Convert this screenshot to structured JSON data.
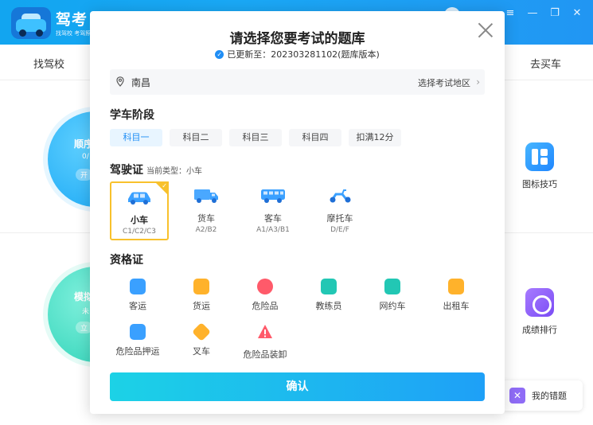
{
  "app": {
    "title": "驾考",
    "subtitle": "找驾校 考驾照"
  },
  "topnav": {
    "left": "找驾校",
    "right": "去买车"
  },
  "background": {
    "circle1": {
      "title": "顺序",
      "sub": "0/",
      "pill": "开"
    },
    "circle2": {
      "title": "模拟",
      "sub": "未",
      "pill": "立"
    },
    "tools": [
      {
        "label": "图标技巧",
        "icon": "grid-icon"
      },
      {
        "label": "成绩排行",
        "icon": "rank-icon"
      }
    ],
    "mistake": {
      "label": "我的错题",
      "icon": "x-icon"
    }
  },
  "modal": {
    "title": "请选择您要考试的题库",
    "update": "已更新至：202303281102(题库版本)",
    "location": {
      "city": "南昌",
      "change_label": "选择考试地区"
    },
    "stage_title": "学车阶段",
    "subjects": [
      "科目一",
      "科目二",
      "科目三",
      "科目四",
      "扣满12分"
    ],
    "active_subject": 0,
    "license_title": "驾驶证",
    "license_current": "当前类型：小车",
    "licenses": [
      {
        "name": "小车",
        "codes": "C1/C2/C3",
        "color": "#3aa0ff"
      },
      {
        "name": "货车",
        "codes": "A2/B2",
        "color": "#4aa8ff"
      },
      {
        "name": "客车",
        "codes": "A1/A3/B1",
        "color": "#3aa0ff"
      },
      {
        "name": "摩托车",
        "codes": "D/E/F",
        "color": "#3aa0ff"
      }
    ],
    "qual_title": "资格证",
    "qualifications": [
      {
        "label": "客运",
        "color": "#3aa0ff"
      },
      {
        "label": "货运",
        "color": "#ffb22b"
      },
      {
        "label": "危险品",
        "color": "#ff5a6a"
      },
      {
        "label": "教练员",
        "color": "#22c7b4"
      },
      {
        "label": "网约车",
        "color": "#22c7b4"
      },
      {
        "label": "出租车",
        "color": "#ffb22b"
      },
      {
        "label": "危险品押运",
        "color": "#3aa0ff"
      },
      {
        "label": "叉车",
        "color": "#ffb22b"
      },
      {
        "label": "危险品装卸",
        "color": "#ff5a6a"
      }
    ],
    "confirm": "确认"
  },
  "window_controls": [
    "≡",
    "—",
    "❐",
    "✕"
  ]
}
